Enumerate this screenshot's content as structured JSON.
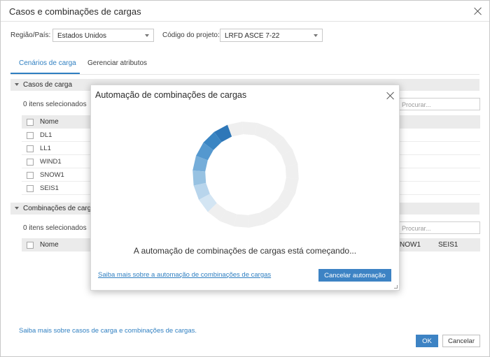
{
  "dialog": {
    "title": "Casos e combinações de cargas"
  },
  "header": {
    "region_label": "Região/País:",
    "region_value": "Estados Unidos",
    "code_label": "Código do projeto:",
    "code_value": "LRFD ASCE 7-22"
  },
  "tabs": [
    {
      "label": "Cenários de carga",
      "active": true
    },
    {
      "label": "Gerenciar atributos",
      "active": false
    }
  ],
  "load_cases": {
    "section_label": "Casos de carga",
    "selected_text": "0 itens selecionados",
    "search_placeholder": "Procurar...",
    "column_name": "Nome",
    "rows": [
      "DL1",
      "LL1",
      "WIND1",
      "SNOW1",
      "SEIS1"
    ]
  },
  "load_combinations": {
    "section_label": "Combinações de cargas",
    "selected_text": "0 itens selecionados",
    "search_placeholder": "Procurar...",
    "column_name": "Nome",
    "visible_columns": [
      "NOW1",
      "SEIS1"
    ]
  },
  "footer": {
    "help_link": "Saiba mais sobre casos de carga e combinações de cargas.",
    "ok_label": "OK",
    "cancel_label": "Cancelar"
  },
  "modal": {
    "title": "Automação de combinações de cargas",
    "message": "A automação de combinações de cargas está começando...",
    "help_link": "Saiba mais sobre a automação de combinações de cargas",
    "cancel_label": "Cancelar automação",
    "progress_fraction": 0.33
  },
  "colors": {
    "accent": "#2f7fc1",
    "button": "#3d83c4",
    "header_bg": "#ebebeb",
    "spinner_track": "#efefef"
  }
}
